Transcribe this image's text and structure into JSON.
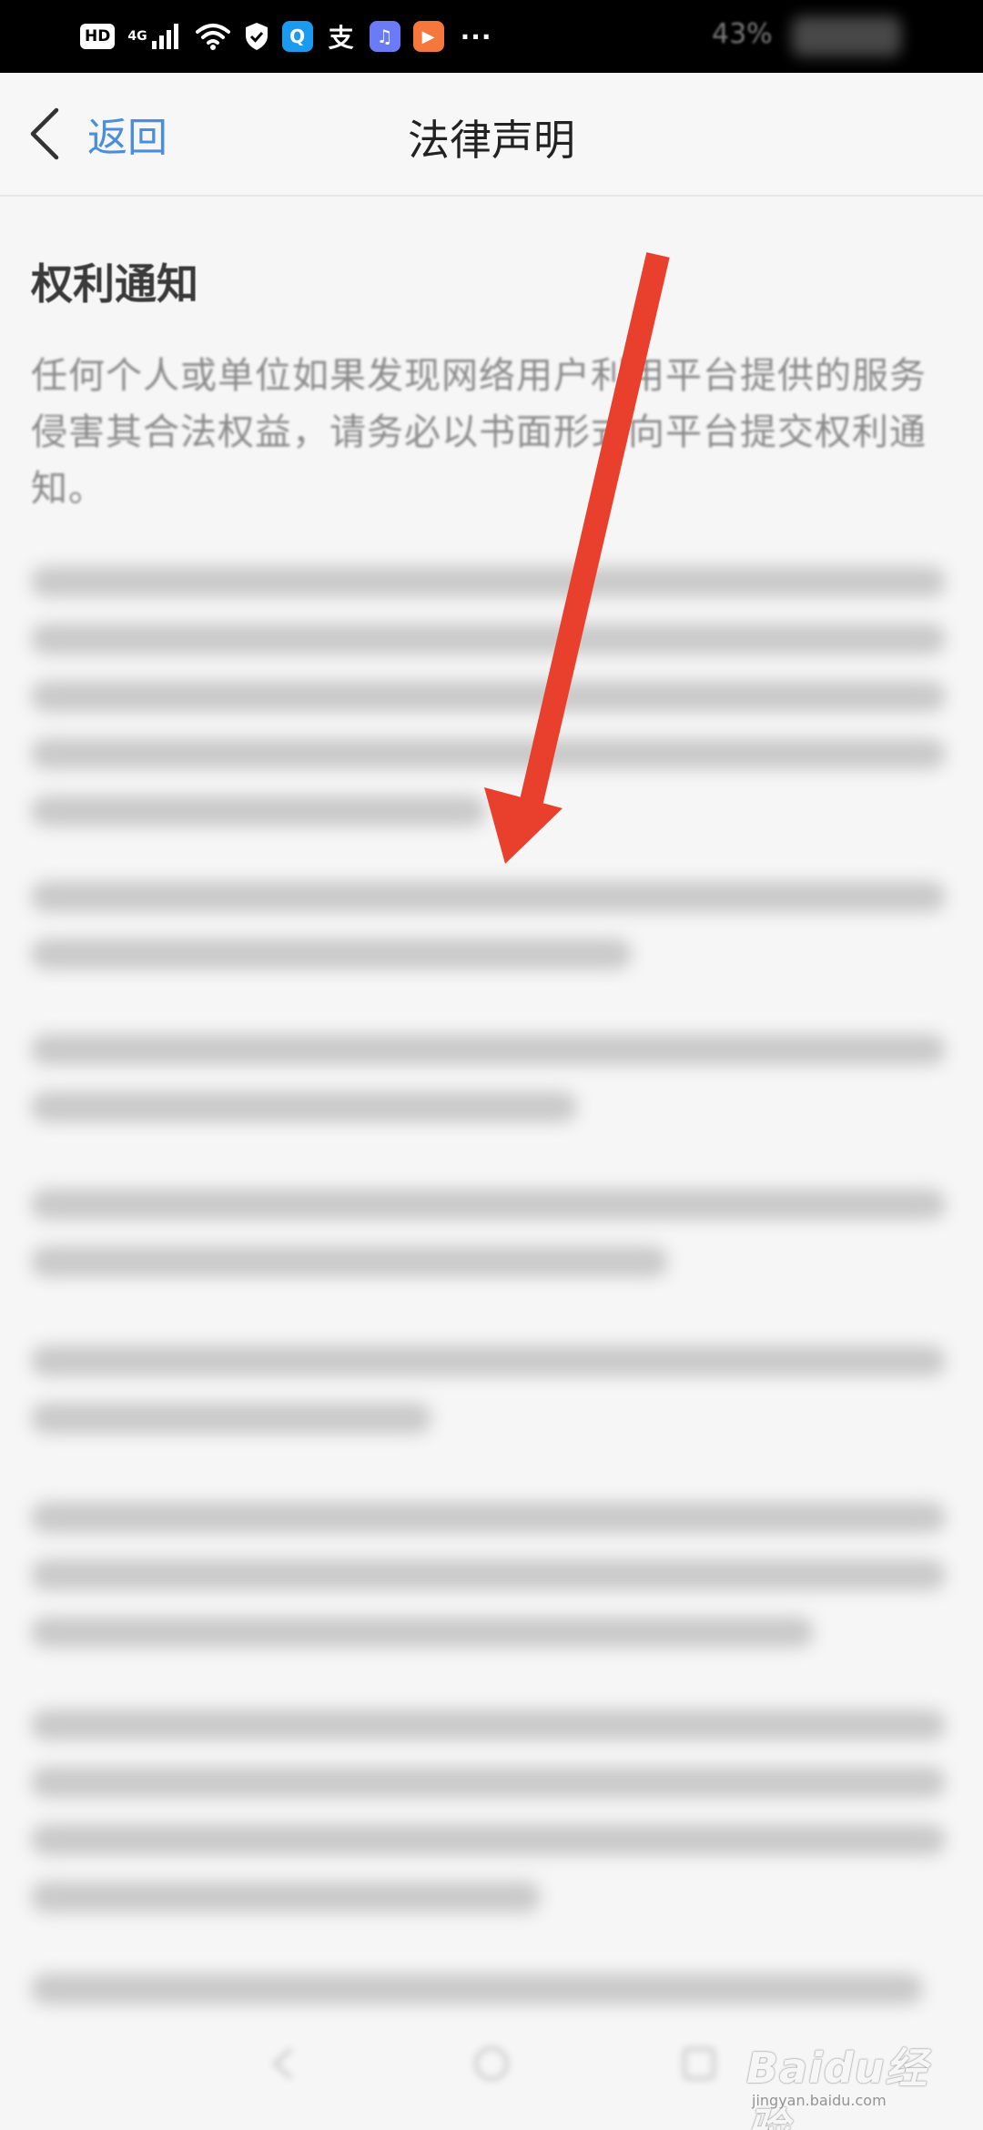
{
  "status_bar": {
    "hd_label": "HD",
    "network_label": "4G",
    "battery_text": "43%",
    "more_label": "···",
    "app_icons": [
      {
        "name": "search-app-icon",
        "glyph": "Q",
        "color": "#1a9bf0"
      },
      {
        "name": "alipay-app-icon",
        "glyph": "支",
        "color": "transparent"
      },
      {
        "name": "music-app-icon",
        "glyph": "♫",
        "color": "#6a7bf5"
      },
      {
        "name": "video-app-icon",
        "glyph": "▶",
        "color": "#f4783c"
      }
    ]
  },
  "nav": {
    "back_label": "返回",
    "title": "法律声明"
  },
  "content": {
    "heading": "权利通知",
    "intro": "任何个人或单位如果发现网络用户利用平台提供的服务侵害其合法权益，请务必以书面形式向平台提交权利通知。"
  },
  "watermark": {
    "logo": "Baidu经验",
    "url": "jingyan.baidu.com"
  },
  "colors": {
    "accent": "#4a8fdd",
    "arrow": "#e8402c",
    "status_bar_bg": "#000000",
    "page_bg": "#f6f6f6"
  }
}
